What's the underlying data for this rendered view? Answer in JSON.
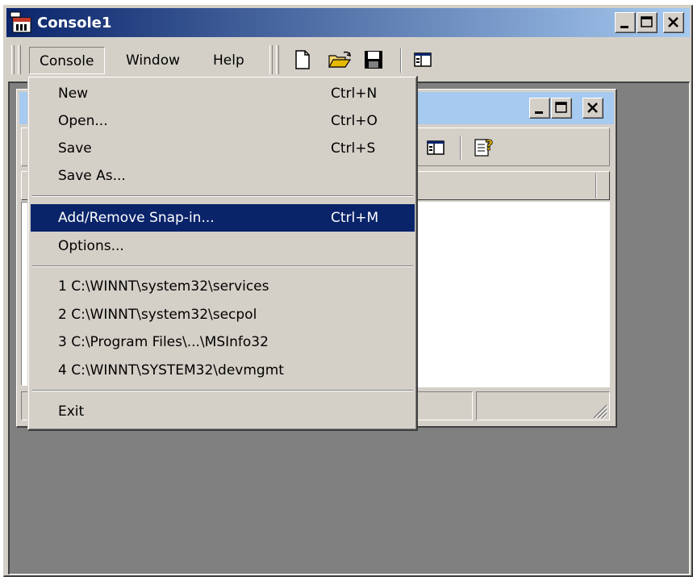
{
  "window": {
    "title": "Console1"
  },
  "menubar": {
    "items": [
      {
        "label": "Console"
      },
      {
        "label": "Window"
      },
      {
        "label": "Help"
      }
    ]
  },
  "console_menu": {
    "items": [
      {
        "label": "New",
        "shortcut": "Ctrl+N"
      },
      {
        "label": "Open...",
        "shortcut": "Ctrl+O"
      },
      {
        "label": "Save",
        "shortcut": "Ctrl+S"
      },
      {
        "label": "Save As...",
        "shortcut": ""
      },
      {
        "label": "Add/Remove Snap-in...",
        "shortcut": "Ctrl+M"
      },
      {
        "label": "Options...",
        "shortcut": ""
      },
      {
        "label": "1 C:\\WINNT\\system32\\services",
        "shortcut": ""
      },
      {
        "label": "2 C:\\WINNT\\system32\\secpol",
        "shortcut": ""
      },
      {
        "label": "3 C:\\Program Files\\...\\MSInfo32",
        "shortcut": ""
      },
      {
        "label": "4 C:\\WINNT\\SYSTEM32\\devmgmt",
        "shortcut": ""
      },
      {
        "label": "Exit",
        "shortcut": ""
      }
    ],
    "selected_label": "Add/Remove Snap-in..."
  },
  "colors": {
    "titlebar_start": "#0a246a",
    "titlebar_end": "#a6caf0",
    "face": "#d4d0c8",
    "mdi_bg": "#808080",
    "selection": "#0a246a"
  },
  "icons": [
    "mmc-app-icon",
    "minimize-icon",
    "maximize-icon",
    "close-icon",
    "new-document-icon",
    "open-folder-icon",
    "save-disk-icon",
    "show-hide-tree-icon",
    "help-icon"
  ]
}
